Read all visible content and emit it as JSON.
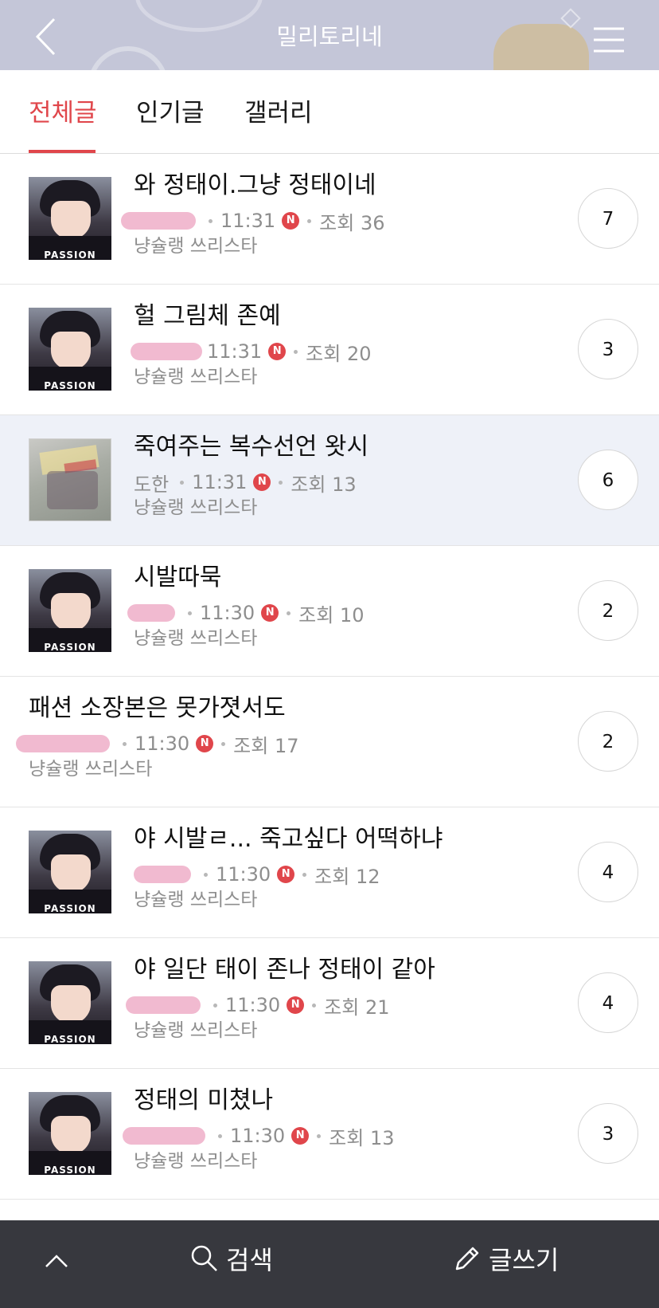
{
  "header": {
    "title": "밀리토리네"
  },
  "tabs": [
    {
      "label": "전체글",
      "active": true
    },
    {
      "label": "인기글",
      "active": false
    },
    {
      "label": "갤러리",
      "active": false
    }
  ],
  "posts": [
    {
      "title": "와 정태이.그냥 정태이네",
      "author": "",
      "author_redacted": true,
      "time": "11:31",
      "is_new": true,
      "views_label": "조회 36",
      "board": "냥슐랭 쓰리스타",
      "comments": "7",
      "thumbnail": "character-portrait",
      "highlighted": false
    },
    {
      "title": "헐 그림체 존예",
      "author": "",
      "author_redacted": true,
      "time": "11:31",
      "is_new": true,
      "views_label": "조회 20",
      "board": "냥슐랭 쓰리스타",
      "comments": "3",
      "thumbnail": "character-portrait",
      "highlighted": false
    },
    {
      "title": "죽여주는 복수선언 왓시",
      "author": "도한",
      "author_redacted": false,
      "time": "11:31",
      "is_new": true,
      "views_label": "조회 13",
      "board": "냥슐랭 쓰리스타",
      "comments": "6",
      "thumbnail": "book-cover",
      "highlighted": true
    },
    {
      "title": "시발따묵",
      "author": "",
      "author_redacted": true,
      "time": "11:30",
      "is_new": true,
      "views_label": "조회 10",
      "board": "냥슐랭 쓰리스타",
      "comments": "2",
      "thumbnail": "character-portrait",
      "highlighted": false
    },
    {
      "title": "패션 소장본은 못가졋서도",
      "author": "",
      "author_redacted": true,
      "time": "11:30",
      "is_new": true,
      "views_label": "조회 17",
      "board": "냥슐랭 쓰리스타",
      "comments": "2",
      "thumbnail": "none",
      "highlighted": false
    },
    {
      "title": "야 시발ㄹ... 죽고싶다 어떡하냐",
      "author": "",
      "author_redacted": true,
      "time": "11:30",
      "is_new": true,
      "views_label": "조회 12",
      "board": "냥슐랭 쓰리스타",
      "comments": "4",
      "thumbnail": "character-portrait",
      "highlighted": false
    },
    {
      "title": "야 일단 태이 존나 정태이 같아",
      "author": "",
      "author_redacted": true,
      "time": "11:30",
      "is_new": true,
      "views_label": "조회 21",
      "board": "냥슐랭 쓰리스타",
      "comments": "4",
      "thumbnail": "character-portrait",
      "highlighted": false
    },
    {
      "title": "정태의 미쳤나",
      "author": "",
      "author_redacted": true,
      "time": "11:30",
      "is_new": true,
      "views_label": "조회 13",
      "board": "냥슐랭 쓰리스타",
      "comments": "3",
      "thumbnail": "character-portrait",
      "highlighted": false
    }
  ],
  "badges": {
    "new_label": "N"
  },
  "thumbnail_logo": "PASSION",
  "bottom_bar": {
    "search_label": "검색",
    "write_label": "글쓰기"
  },
  "icons": {
    "back": "chevron-left-icon",
    "menu": "hamburger-menu-icon",
    "scroll_top": "chevron-up-icon",
    "search": "search-icon",
    "write": "pencil-icon"
  },
  "colors": {
    "accent": "#e0464b",
    "header_bg": "#c4c6d8",
    "highlight_row": "#eef1f8",
    "bottom_bar_bg": "#37383e",
    "meta_text": "#8e8e8e",
    "redaction": "#f0b6cd"
  }
}
